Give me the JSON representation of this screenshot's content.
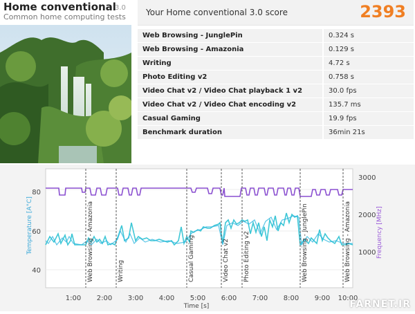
{
  "header": {
    "title": "Home conventional",
    "version": "3.0",
    "subtitle": "Common home computing tests"
  },
  "score": {
    "label": "Your Home conventional 3.0 score",
    "value": "2393"
  },
  "results": [
    {
      "name": "Web Browsing - JunglePin",
      "value": "0.324 s"
    },
    {
      "name": "Web Browsing - Amazonia",
      "value": "0.129 s"
    },
    {
      "name": "Writing",
      "value": "4.72 s"
    },
    {
      "name": "Photo Editing v2",
      "value": "0.758 s"
    },
    {
      "name": "Video Chat v2 / Video Chat playback 1 v2",
      "value": "30.0 fps"
    },
    {
      "name": "Video Chat v2 / Video Chat encoding v2",
      "value": "135.7 ms"
    },
    {
      "name": "Casual Gaming",
      "value": "19.9 fps"
    },
    {
      "name": "Benchmark duration",
      "value": "36min 21s"
    }
  ],
  "chart": {
    "xlabel": "Time [s]",
    "ylabel_left": "Temperature [A°C]",
    "ylabel_right": "Frequency [MHz]",
    "left_ticks": [
      "80",
      "60",
      "40"
    ],
    "right_ticks": [
      "3000",
      "2000",
      "1000"
    ],
    "x_ticks": [
      "1:00",
      "2:00",
      "3:00",
      "4:00",
      "5:00",
      "6:00",
      "7:00",
      "8:00",
      "9:00",
      "10:00"
    ],
    "markers": [
      "Web Browsing - Amazonia",
      "Writing",
      "Casual Gaming",
      "Video Chat v2",
      "Photo Editing v2",
      "Web Browsing - JunglePin",
      "Web Browsing - Amazonia"
    ],
    "colors": {
      "temperature": "#3ec7d6",
      "frequency": "#8a4fd0",
      "frequency_label": "#9a5ad8",
      "temperature_label": "#3aa8d8"
    }
  },
  "watermark": "FARNET.IR"
}
